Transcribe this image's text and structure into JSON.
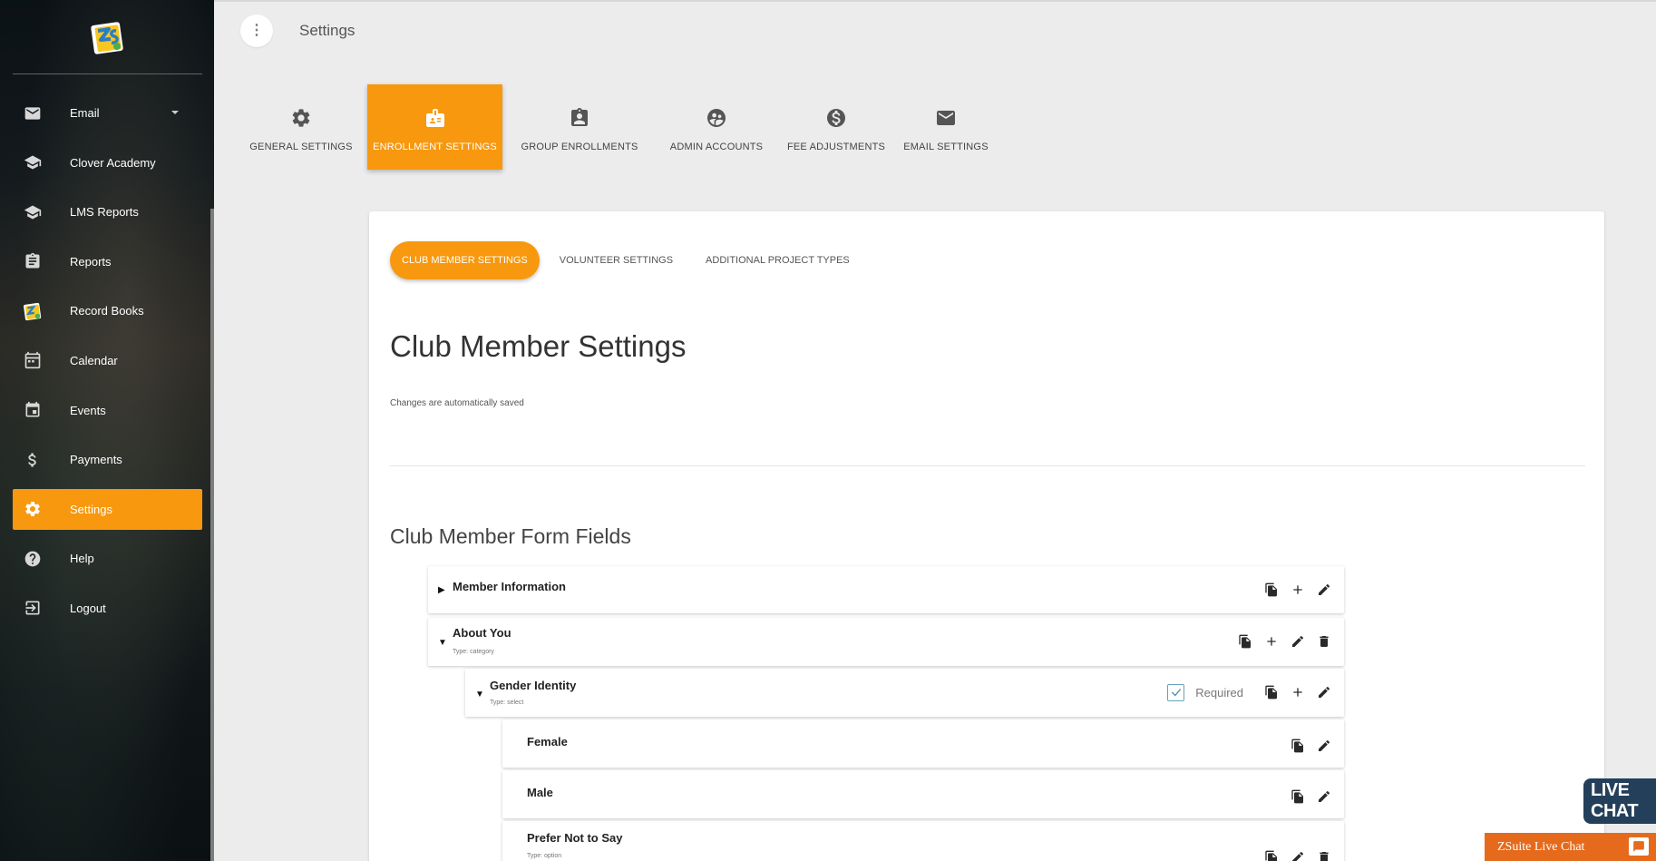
{
  "header": {
    "title": "Settings"
  },
  "sidebar": {
    "items": [
      {
        "label": "Email",
        "icon": "email-icon"
      },
      {
        "label": "Clover Academy",
        "icon": "graduation-cap-icon"
      },
      {
        "label": "LMS Reports",
        "icon": "graduation-cap-icon"
      },
      {
        "label": "Reports",
        "icon": "clipboard-icon"
      },
      {
        "label": "Record Books",
        "icon": "zsuite-logo-icon"
      },
      {
        "label": "Calendar",
        "icon": "calendar-icon"
      },
      {
        "label": "Events",
        "icon": "event-icon"
      },
      {
        "label": "Payments",
        "icon": "dollar-icon"
      },
      {
        "label": "Settings",
        "icon": "gear-icon"
      },
      {
        "label": "Help",
        "icon": "help-icon"
      },
      {
        "label": "Logout",
        "icon": "logout-icon"
      }
    ]
  },
  "tabs": [
    {
      "label": "GENERAL SETTINGS"
    },
    {
      "label": "ENROLLMENT SETTINGS"
    },
    {
      "label": "GROUP ENROLLMENTS"
    },
    {
      "label": "ADMIN ACCOUNTS"
    },
    {
      "label": "FEE ADJUSTMENTS"
    },
    {
      "label": "EMAIL SETTINGS"
    }
  ],
  "subtabs": [
    {
      "label": "CLUB MEMBER SETTINGS"
    },
    {
      "label": "VOLUNTEER SETTINGS"
    },
    {
      "label": "ADDITIONAL PROJECT TYPES"
    }
  ],
  "content": {
    "title": "Club Member Settings",
    "autosave": "Changes are automatically saved",
    "section_title": "Club Member Form Fields"
  },
  "fields": {
    "member_information": {
      "label": "Member Information"
    },
    "about_you": {
      "label": "About You",
      "type": "Type: category"
    },
    "gender_identity": {
      "label": "Gender Identity",
      "type": "Type: select",
      "required_label": "Required"
    },
    "female": {
      "label": "Female"
    },
    "male": {
      "label": "Male"
    },
    "prefer_not": {
      "label": "Prefer Not to Say",
      "type": "Type: option"
    }
  },
  "chat": {
    "badge": "LIVE CHAT",
    "bar": "ZSuite Live Chat"
  },
  "colors": {
    "accent": "#f7980f",
    "chat_orange": "#e66a1c",
    "chat_navy": "#243f59"
  }
}
